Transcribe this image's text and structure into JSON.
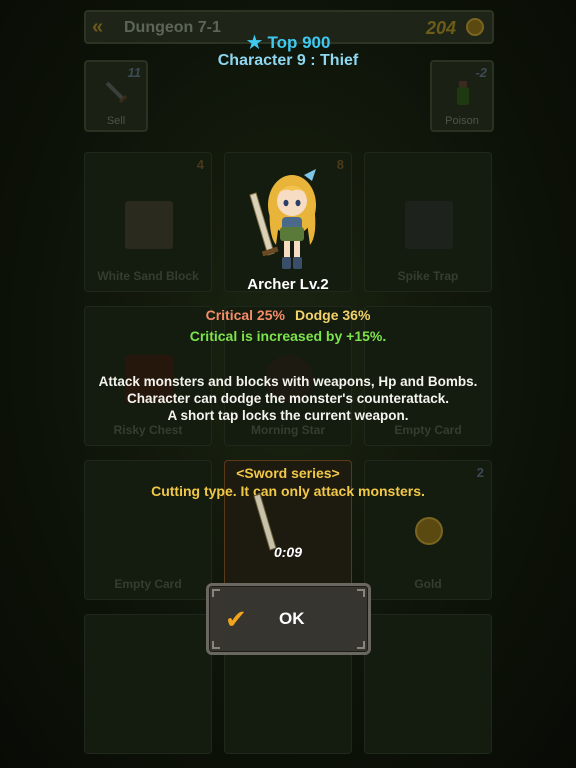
{
  "header": {
    "back_icon": "double-chevron-left-icon",
    "dungeon": "Dungeon 7-1",
    "gold": "204",
    "coin_icon": "gold-coin-icon"
  },
  "tools": {
    "sell": {
      "label": "Sell",
      "count": "11",
      "icon": "sword-icon"
    },
    "poison": {
      "label": "Poison",
      "count": "-2",
      "icon": "potion-icon"
    }
  },
  "cards": [
    {
      "name": "White Sand Block",
      "num": "4"
    },
    {
      "name": "",
      "num": "8"
    },
    {
      "name": "Spike Trap",
      "num": ""
    },
    {
      "name": "Risky Chest",
      "num": ""
    },
    {
      "name": "Morning Star",
      "num": ""
    },
    {
      "name": "Empty Card",
      "num": ""
    },
    {
      "name": "Empty Card",
      "num": ""
    },
    {
      "name": "",
      "num": ""
    },
    {
      "name": "Gold",
      "num": "2"
    }
  ],
  "dialog": {
    "rank": "Top 900",
    "character": "Character 9 : Thief",
    "hero_name": "Archer  Lv.2",
    "critical": "Critical 25%",
    "dodge": "Dodge 36%",
    "bonus": "Critical is increased by +15%.",
    "desc": [
      "Attack monsters and blocks with weapons, Hp and Bombs.",
      "Character can dodge the monster's counterattack.",
      "A short tap locks the current weapon."
    ],
    "series_title": "<Sword series>",
    "series_desc": "Cutting type. It can only attack monsters.",
    "timer": "0:09",
    "ok": "OK"
  },
  "colors": {
    "rank": "#3ec9f0",
    "critical": "#f58c6a",
    "dodge": "#f2d36b",
    "bonus": "#7de34c",
    "series": "#f2c848",
    "ok_check": "#f2a51c"
  }
}
